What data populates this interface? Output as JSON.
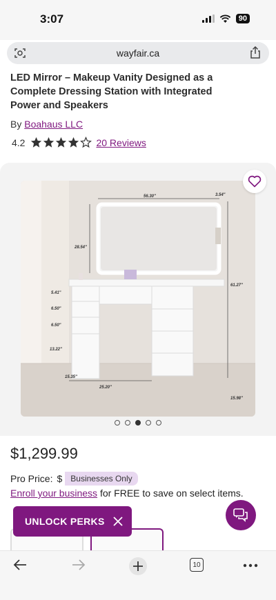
{
  "status": {
    "time": "3:07",
    "battery": "90"
  },
  "browser": {
    "url": "wayfair.ca",
    "tabs_count": "10"
  },
  "product": {
    "title_line1": "LED Mirror – Makeup Vanity Designed as a",
    "title_line2": "Complete Dressing Station with Integrated",
    "title_line3": "Power and Speakers",
    "by_label": "By",
    "brand": "Boahaus LLC",
    "rating": "4.2",
    "reviews": "20 Reviews",
    "price": "$1,299.99",
    "pro_price_label": "Pro Price:",
    "pro_price_symbol": "$",
    "pro_badge": "Businesses Only",
    "enroll_link": "Enroll your business",
    "enroll_text": " for FREE to save on select items."
  },
  "image_dimensions": {
    "width_mirror": "56.30\"",
    "depth_mirror": "3.54\"",
    "mirror_height": "28.54\"",
    "total_height": "61.27\"",
    "drawer1": "5.41\"",
    "drawer2": "6.50\"",
    "drawer3": "6.50\"",
    "drawer4": "13.22\"",
    "side_depth": "15.35\"",
    "desk_width": "25.20\"",
    "desk_depth": "15.98\""
  },
  "gallery": {
    "dot_count": 5,
    "active_dot": 3
  },
  "promo": {
    "unlock_label": "UNLOCK PERKS"
  },
  "colors": {
    "accent": "#7f187f",
    "badge_bg": "#e8d8f0"
  }
}
